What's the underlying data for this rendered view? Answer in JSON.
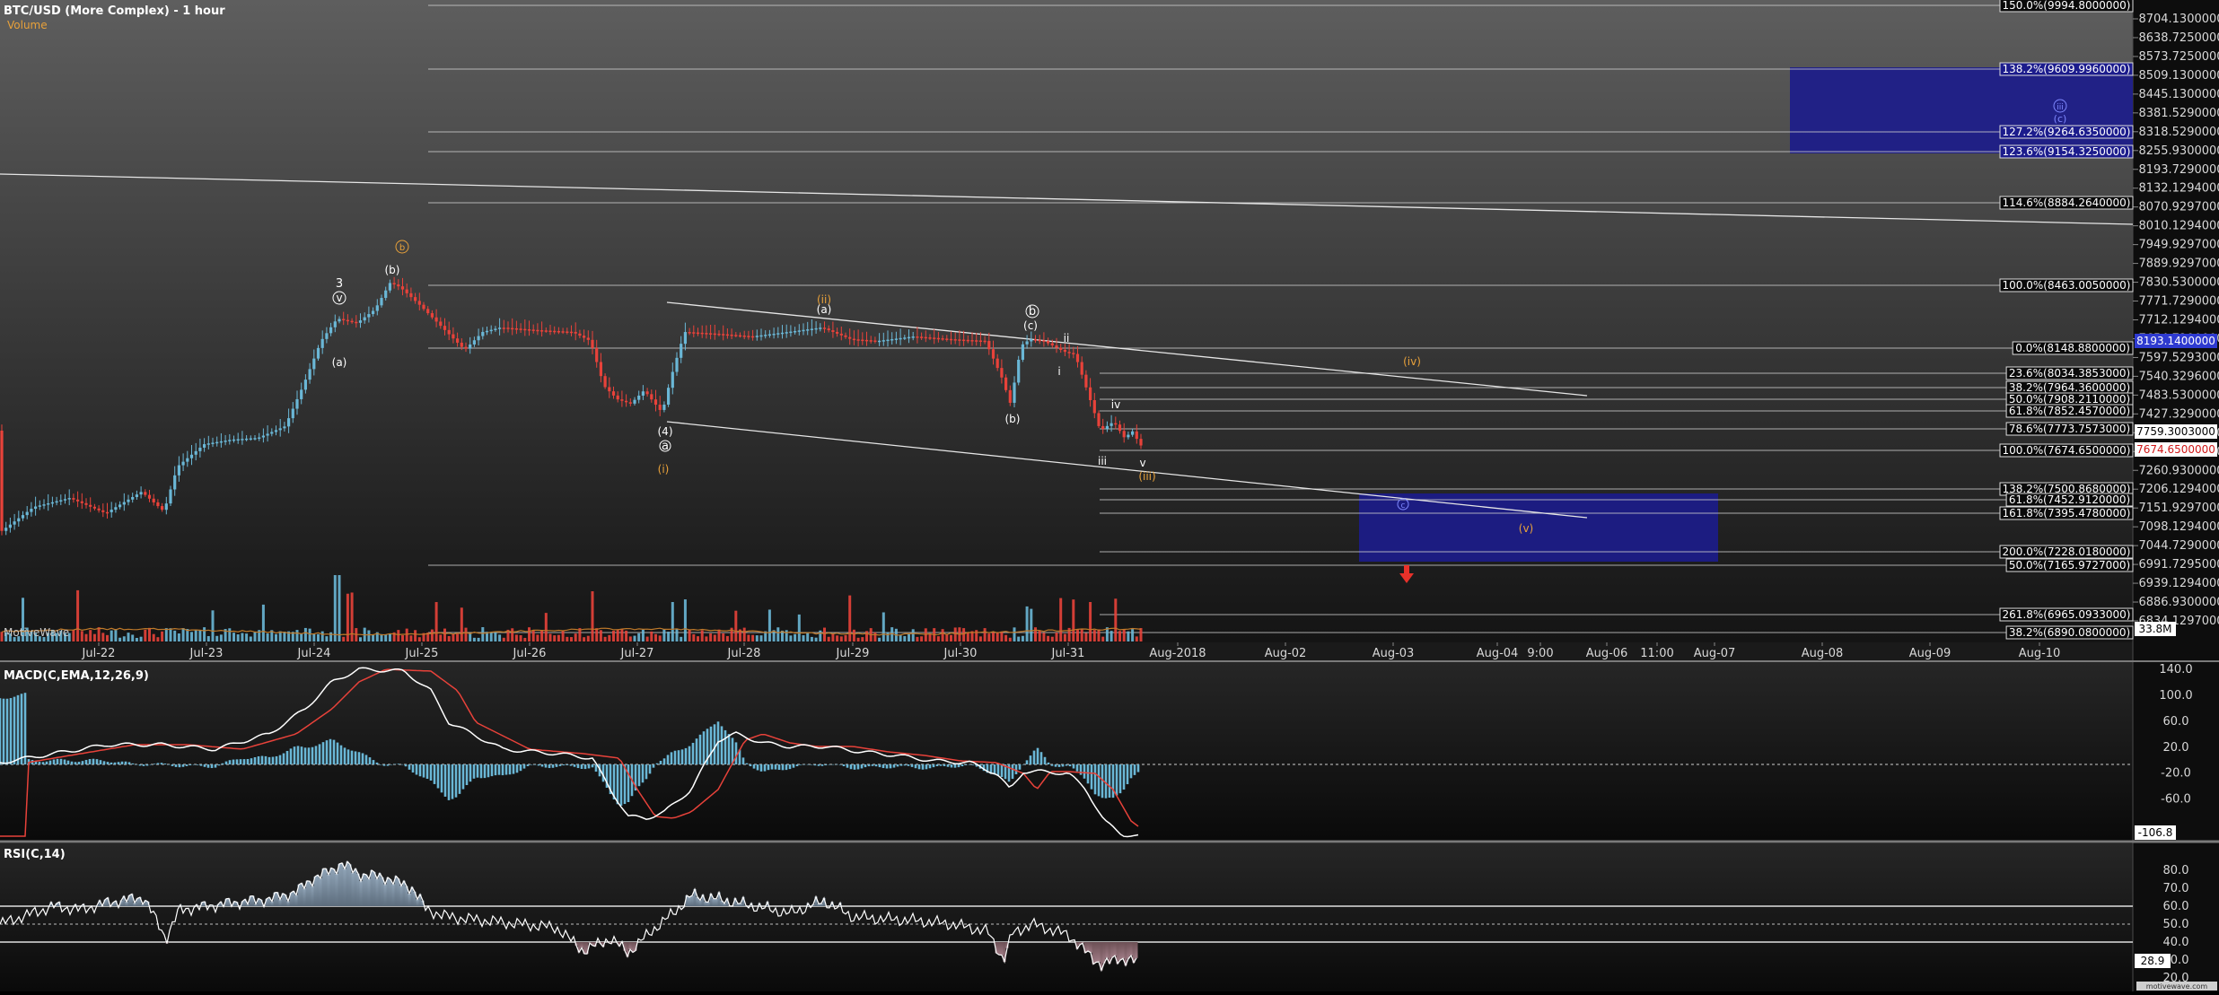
{
  "header": {
    "title": "BTC/USD (More Complex) - 1 hour",
    "subtitle": "Volume",
    "vendor": "MotiveWave",
    "watermark": "motivewave.com"
  },
  "colors": {
    "bullish": "#6ab7d6",
    "bearish": "#e8423a",
    "macd": "#ffffff",
    "signal": "#e8423a",
    "histogram": "#6ab7d6",
    "box": "#1c1c8c",
    "wave_orange": "#e8a13a",
    "wave_blue": "#7f88ff"
  },
  "price_axis": {
    "ticks": [
      "8704.1300000",
      "8638.7250000",
      "8573.7250000",
      "8509.1300000",
      "8445.1300000",
      "8381.5290000",
      "8318.5290000",
      "8255.9300000",
      "8193.7290000",
      "8132.1294000",
      "8070.9297000",
      "8010.1294000",
      "7949.9297000",
      "7889.9297000",
      "7830.5300000",
      "7771.7290000",
      "7712.1294000",
      "7654.7290000",
      "7597.5293000",
      "7540.3296000",
      "7483.5300000",
      "7427.3290000",
      "7371.3290000",
      "7315.9297000",
      "7260.9300000",
      "7206.1294000",
      "7151.9297000",
      "7098.1294000",
      "7044.7290000",
      "6991.7295000",
      "6939.1294000",
      "6886.9300000",
      "6834.1297000"
    ],
    "current_price_label": "8193.1400000",
    "last_price_label": "7759.3003000",
    "close_price_label": "7674.6500000",
    "volume_label": "33.8M"
  },
  "fib_levels": [
    {
      "label": "150.0%(9994.8000000)"
    },
    {
      "label": "138.2%(9609.9960000)",
      "style": "blue"
    },
    {
      "label": "127.2%(9264.6350000)",
      "style": "blue"
    },
    {
      "label": "123.6%(9154.3250000)",
      "style": "blue"
    },
    {
      "label": "114.6%(8884.2640000)"
    },
    {
      "label": "100.0%(8463.0050000)"
    },
    {
      "label": "0.0%(8148.8800000)"
    },
    {
      "label": "23.6%(8034.3853000)"
    },
    {
      "label": "38.2%(7964.3600000)"
    },
    {
      "label": "50.0%(7908.2110000)"
    },
    {
      "label": "61.8%(7852.4570000)"
    },
    {
      "label": "78.6%(7773.7573000)"
    },
    {
      "label": "100.0%(7674.6500000)"
    },
    {
      "label": "138.2%(7500.8680000)"
    },
    {
      "label": "61.8%(7452.9120000)"
    },
    {
      "label": "161.8%(7395.4780000)"
    },
    {
      "label": "200.0%(7228.0180000)"
    },
    {
      "label": "50.0%(7165.9727000)"
    },
    {
      "label": "261.8%(6965.0933000)"
    },
    {
      "label": "38.2%(6890.0800000)"
    }
  ],
  "time_axis": [
    "Jul-22",
    "Jul-23",
    "Jul-24",
    "Jul-25",
    "Jul-26",
    "Jul-27",
    "Jul-28",
    "Jul-29",
    "Jul-30",
    "Jul-31",
    "Aug-2018",
    "Aug-02",
    "Aug-03",
    "Aug-04",
    "9:00",
    "Aug-06",
    "11:00",
    "Aug-07",
    "Aug-08",
    "Aug-09",
    "Aug-10"
  ],
  "wave_labels": [
    "3",
    "(b)",
    "(a)",
    "b",
    "(ii)",
    "(a)",
    "(c)",
    "b",
    "ii",
    "i",
    "(b)",
    "iv",
    "iii",
    "v",
    "(iii)",
    "(iv)",
    "(v)",
    "(i)",
    "(4)",
    "a",
    "c",
    "iii",
    "(c)"
  ],
  "macd": {
    "label": "MACD(C,EMA,12,26,9)",
    "ticks": [
      "140.0",
      "100.0",
      "60.0",
      "20.0",
      "-20.0",
      "-60.0"
    ],
    "current": "-106.8"
  },
  "rsi": {
    "label": "RSI(C,14)",
    "ticks": [
      "80.0",
      "70.0",
      "60.0",
      "50.0",
      "40.0",
      "30.0",
      "20.0"
    ],
    "current": "28.9"
  },
  "chart_data": {
    "type": "line",
    "title": "BTC/USD (More Complex) - 1 hour",
    "series": [
      {
        "name": "Volume"
      },
      {
        "name": "MACD(C,EMA,12,26,9)"
      },
      {
        "name": "RSI(C,14)"
      }
    ],
    "x": [
      "Jul-22",
      "Jul-23",
      "Jul-24",
      "Jul-25",
      "Jul-26",
      "Jul-27",
      "Jul-28",
      "Jul-29",
      "Jul-30",
      "Jul-31"
    ],
    "ylim": [
      6834,
      8704
    ],
    "price_points": [
      [
        "Jul-22",
        7200
      ],
      [
        "Jul-23",
        7300
      ],
      [
        "Jul-24",
        7650
      ],
      [
        "Jul-25",
        7780
      ],
      [
        "Jul-26",
        7700
      ],
      [
        "Jul-27",
        7450
      ],
      [
        "Jul-28",
        7700
      ],
      [
        "Jul-29",
        7700
      ],
      [
        "Jul-30",
        7680
      ],
      [
        "Jul-31",
        7700
      ],
      [
        "Jul-31",
        7674.65
      ]
    ],
    "macd_ylim": [
      -110,
      150
    ],
    "rsi_ylim": [
      15,
      90
    ]
  }
}
